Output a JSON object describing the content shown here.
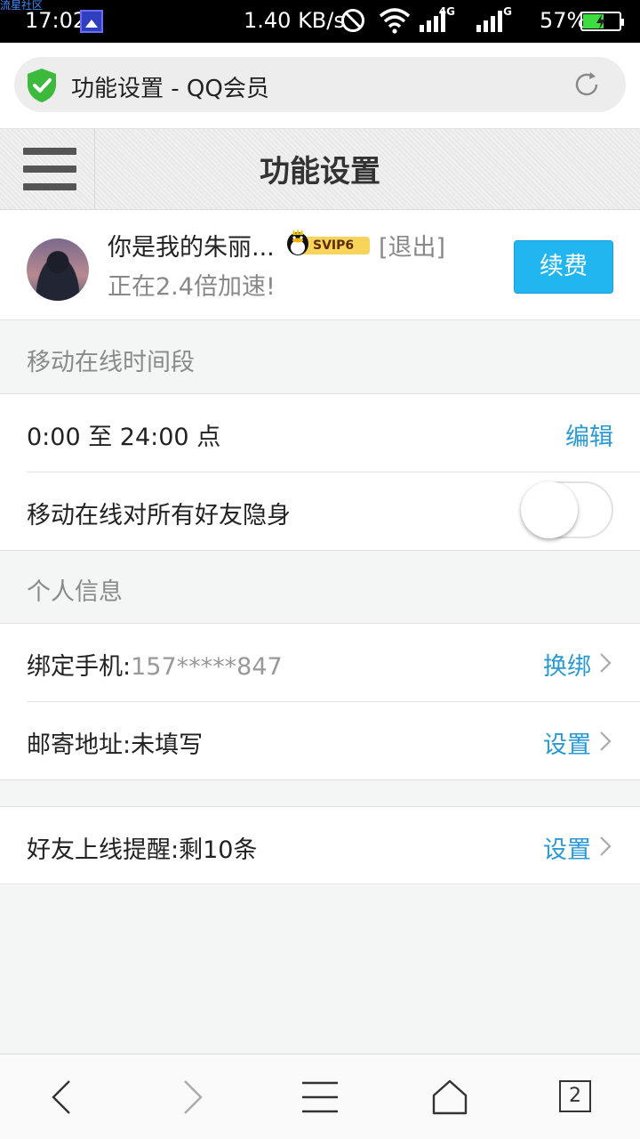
{
  "status_bar": {
    "watermark": "流星社区",
    "time": "17:02",
    "net_speed": "1.40 KB/s",
    "network1": "4G",
    "network2": "G",
    "battery_pct": "57%",
    "battery_level": 0.57
  },
  "address_bar": {
    "url_title": "功能设置 - QQ会员",
    "icons": [
      "shield-check-icon",
      "reload-icon"
    ]
  },
  "title_bar": {
    "title": "功能设置",
    "icons": [
      "hamburger-menu-icon"
    ]
  },
  "user": {
    "name": "你是我的朱丽...",
    "vip_badge": "SVIP6",
    "logout_label": "[退出]",
    "speed_text": "正在2.4倍加速!",
    "renew_label": "续费"
  },
  "sections": {
    "mobile_online": {
      "header": "移动在线时间段",
      "time_range": "0:00 至 24:00 点",
      "edit_label": "编辑",
      "invisible_label": "移动在线对所有好友隐身",
      "invisible_on": false
    },
    "personal_info": {
      "header": "个人信息",
      "phone_label": "绑定手机:",
      "phone_value": "157*****847",
      "phone_action": "换绑",
      "address_label": "邮寄地址:",
      "address_value": "未填写",
      "address_action": "设置"
    },
    "friend_alert": {
      "label": "好友上线提醒:",
      "value": "剩10条",
      "action": "设置"
    }
  },
  "bottom_nav": {
    "tab_count": "2",
    "icons": [
      "back-icon",
      "forward-icon",
      "menu-icon",
      "home-icon",
      "tabs-icon"
    ]
  },
  "colors": {
    "accent": "#2a9ad6",
    "button_bg": "#21b6ef",
    "battery_fill": "#3ddc40",
    "vip_gold": "#f8d55a"
  }
}
